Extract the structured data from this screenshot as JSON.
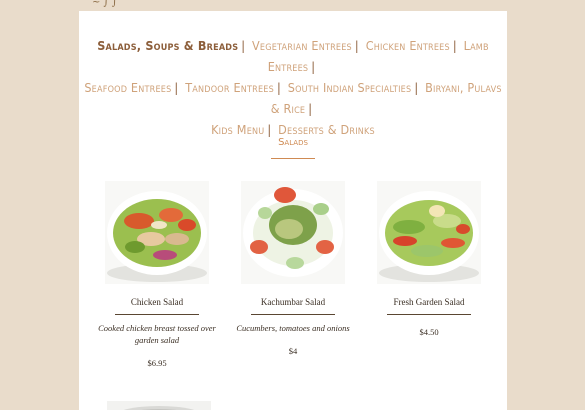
{
  "nav": {
    "items": [
      {
        "label": "Salads, Soups & Breads",
        "active": true
      },
      {
        "label": "Vegetarian Entrees"
      },
      {
        "label": "Chicken Entrees"
      },
      {
        "label": "Lamb Entrees"
      },
      {
        "label": "Seafood Entrees"
      },
      {
        "label": "Tandoor Entrees"
      },
      {
        "label": "South Indian Specialties"
      },
      {
        "label": "Biryani, Pulavs & Rice"
      },
      {
        "label": "Kids Menu"
      },
      {
        "label": "Desserts & Drinks"
      }
    ],
    "separator": "|"
  },
  "section": {
    "title": "Salads"
  },
  "items": [
    {
      "name": "Chicken Salad",
      "description": "Cooked chicken breast tossed over garden salad",
      "price": "$6.95",
      "photo_icon": "chicken-salad-photo"
    },
    {
      "name": "Kachumbar Salad",
      "description": "Cucumbers, tomatoes and onions",
      "price": "$4",
      "photo_icon": "kachumbar-salad-photo"
    },
    {
      "name": "Fresh Garden Salad",
      "description": "",
      "price": "$4.50",
      "photo_icon": "garden-salad-photo"
    }
  ],
  "colors": {
    "background": "#e9dccb",
    "nav_inactive": "#cfa27a",
    "nav_active": "#8c5e3a",
    "section_accent": "#cf8a52",
    "body_text": "#3b2f24"
  }
}
